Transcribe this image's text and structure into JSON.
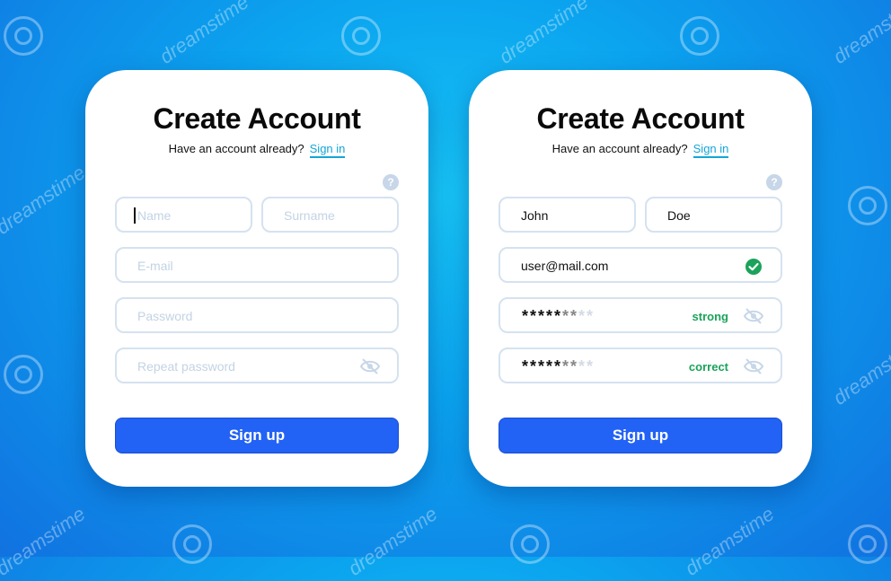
{
  "left_card": {
    "title": "Create Account",
    "have_account": "Have an account already?",
    "sign_in": "Sign in",
    "help": "?",
    "name_placeholder": "Name",
    "surname_placeholder": "Surname",
    "email_placeholder": "E-mail",
    "password_placeholder": "Password",
    "repeat_password_placeholder": "Repeat password",
    "signup_label": "Sign up"
  },
  "right_card": {
    "title": "Create Account",
    "have_account": "Have an account already?",
    "sign_in": "Sign in",
    "help": "?",
    "name_value": "John",
    "surname_value": "Doe",
    "email_value": "user@mail.com",
    "password_dark": "*****",
    "password_mid": "**",
    "password_light": "**",
    "password_strength": "strong",
    "repeat_dark": "*****",
    "repeat_mid": "**",
    "repeat_light": "**",
    "repeat_status": "correct",
    "signup_label": "Sign up"
  },
  "watermark": {
    "text": "dreamstime"
  },
  "colors": {
    "accent": "#2262f5",
    "link": "#13a6d6",
    "success": "#1aa35a",
    "icon_muted": "#c7d6e8"
  },
  "icons": [
    "help-icon",
    "eye-off-icon",
    "check-circle-icon"
  ]
}
